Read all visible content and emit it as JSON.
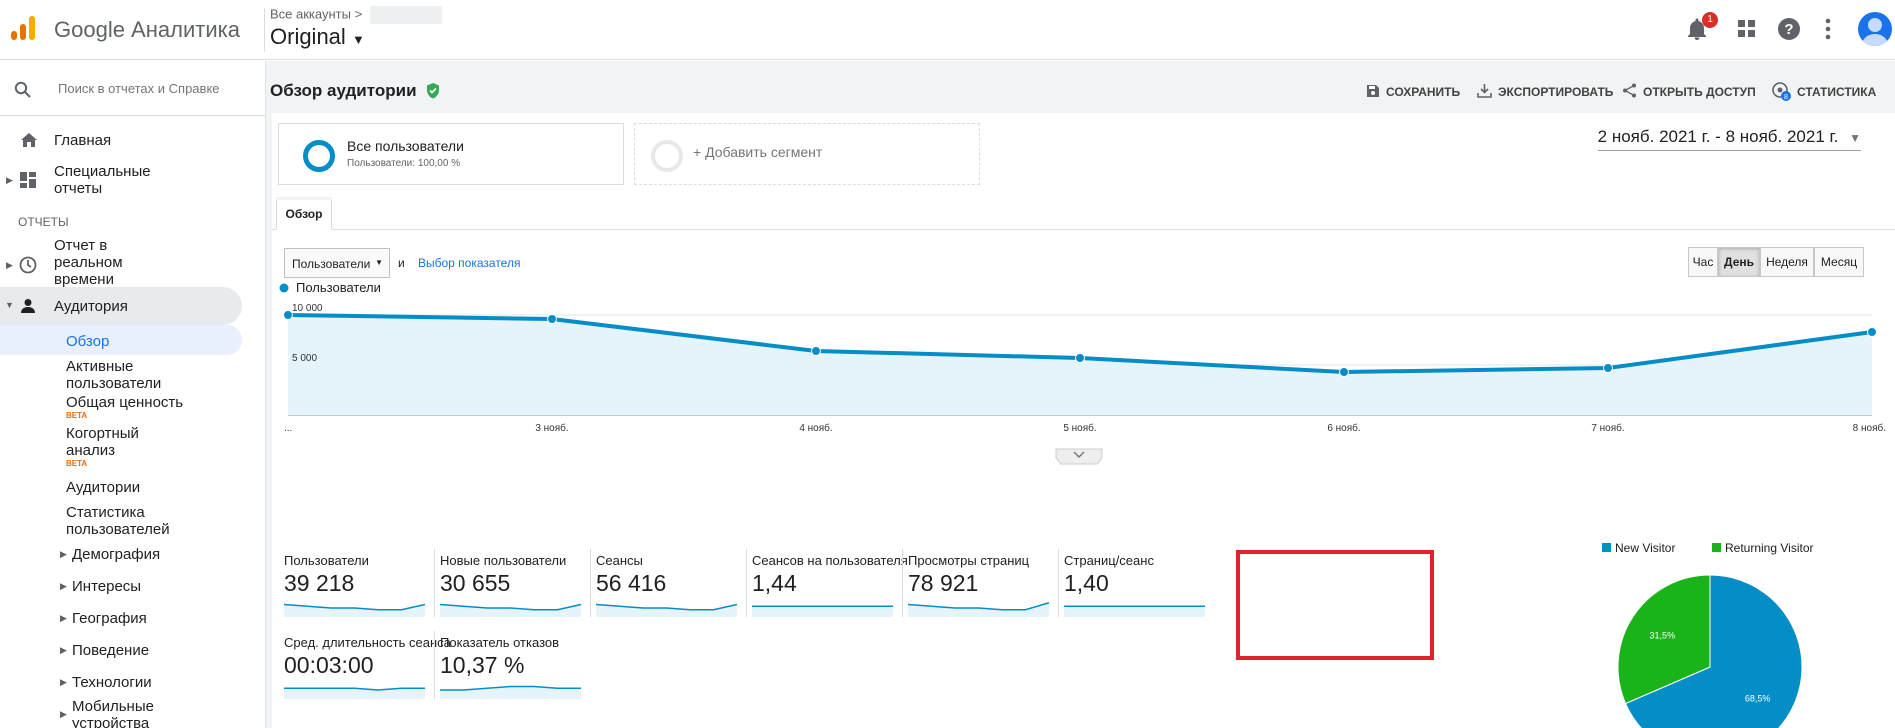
{
  "header": {
    "brand": "Google Аналитика",
    "accounts_label": "Все аккаунты",
    "property": "Original",
    "notif_count": "1"
  },
  "sidebar": {
    "search_placeholder": "Поиск в отчетах и Справке",
    "home": "Главная",
    "custom": [
      "Специальные",
      "отчеты"
    ],
    "section": "ОТЧЕТЫ",
    "realtime": [
      "Отчет в",
      "реальном",
      "времени"
    ],
    "audience": "Аудитория",
    "overview": "Обзор",
    "active_users": [
      "Активные",
      "пользователи"
    ],
    "lifetime_value": "Общая ценность",
    "beta": "BETA",
    "cohort": [
      "Когортный",
      "анализ"
    ],
    "audiences": "Аудитории",
    "user_explorer": [
      "Статистика",
      "пользователей"
    ],
    "demographics": "Демография",
    "interests": "Интересы",
    "geo": "География",
    "behavior": "Поведение",
    "technology": "Технологии",
    "mobile": [
      "Мобильные",
      "устройства"
    ]
  },
  "page": {
    "title": "Обзор аудитории",
    "actions": {
      "save": "СОХРАНИТЬ",
      "export": "ЭКСПОРТИРОВАТЬ",
      "share": "ОТКРЫТЬ ДОСТУП",
      "insights": "СТАТИСТИКА",
      "insights_count": "8"
    },
    "date_range": "2 нояб. 2021 г. - 8 нояб. 2021 г.",
    "segment1": {
      "title": "Все пользователи",
      "sub": "Пользователи: 100,00 %"
    },
    "segment2": {
      "title": "+ Добавить сегмент"
    },
    "tab": "Обзор",
    "metric_select": "Пользователи",
    "and": "и",
    "metric_link": "Выбор показателя",
    "granularity": [
      "Час",
      "День",
      "Неделя",
      "Месяц"
    ],
    "granularity_selected": "День"
  },
  "colors": {
    "accent": "#058dc7",
    "returning": "#1ab41a",
    "highlight": "#e0222a",
    "verified": "#34a853"
  },
  "chart_data": [
    {
      "type": "area",
      "series": [
        {
          "name": "Пользователи",
          "values": [
            10000,
            9600,
            6400,
            5700,
            4300,
            4700,
            8300
          ]
        }
      ],
      "x": [
        "...",
        "3 нояб.",
        "4 нояб.",
        "5 нояб.",
        "6 нояб.",
        "7 нояб.",
        "8 нояб."
      ],
      "yticks": [
        "10 000",
        "5 000"
      ],
      "ylim": [
        0,
        11200
      ],
      "grid": true
    },
    {
      "type": "pie",
      "labels": [
        "New Visitor",
        "Returning Visitor"
      ],
      "values": [
        68.5,
        31.5
      ],
      "value_labels": [
        "68,5%",
        "31,5%"
      ],
      "legend": "top"
    }
  ],
  "scorecards": [
    {
      "label": "Пользователи",
      "value": "39 218",
      "spark": [
        6,
        5,
        4,
        4,
        3,
        3,
        6
      ]
    },
    {
      "label": "Новые пользователи",
      "value": "30 655",
      "spark": [
        6,
        5,
        4,
        4,
        3,
        3,
        6
      ]
    },
    {
      "label": "Сеансы",
      "value": "56 416",
      "spark": [
        6,
        5,
        4,
        4,
        3,
        3,
        6
      ]
    },
    {
      "label": "Сеансов на пользователя",
      "value": "1,44",
      "spark": [
        5,
        5,
        5,
        5,
        5,
        5,
        5
      ]
    },
    {
      "label": "Просмотры страниц",
      "value": "78 921",
      "spark": [
        6,
        5,
        4,
        4,
        3,
        3,
        7
      ]
    },
    {
      "label": "Страниц/сеанс",
      "value": "1,40",
      "spark": [
        5,
        5,
        5,
        5,
        5,
        5,
        5
      ]
    },
    {
      "label": "Сред. длительность сеанса",
      "value": "00:03:00",
      "spark": [
        5,
        5,
        5,
        5,
        4,
        5,
        5
      ]
    },
    {
      "label": "Показатель отказов",
      "value": "10,37 %",
      "spark": [
        4,
        4,
        5,
        6,
        6,
        5,
        5
      ]
    }
  ]
}
